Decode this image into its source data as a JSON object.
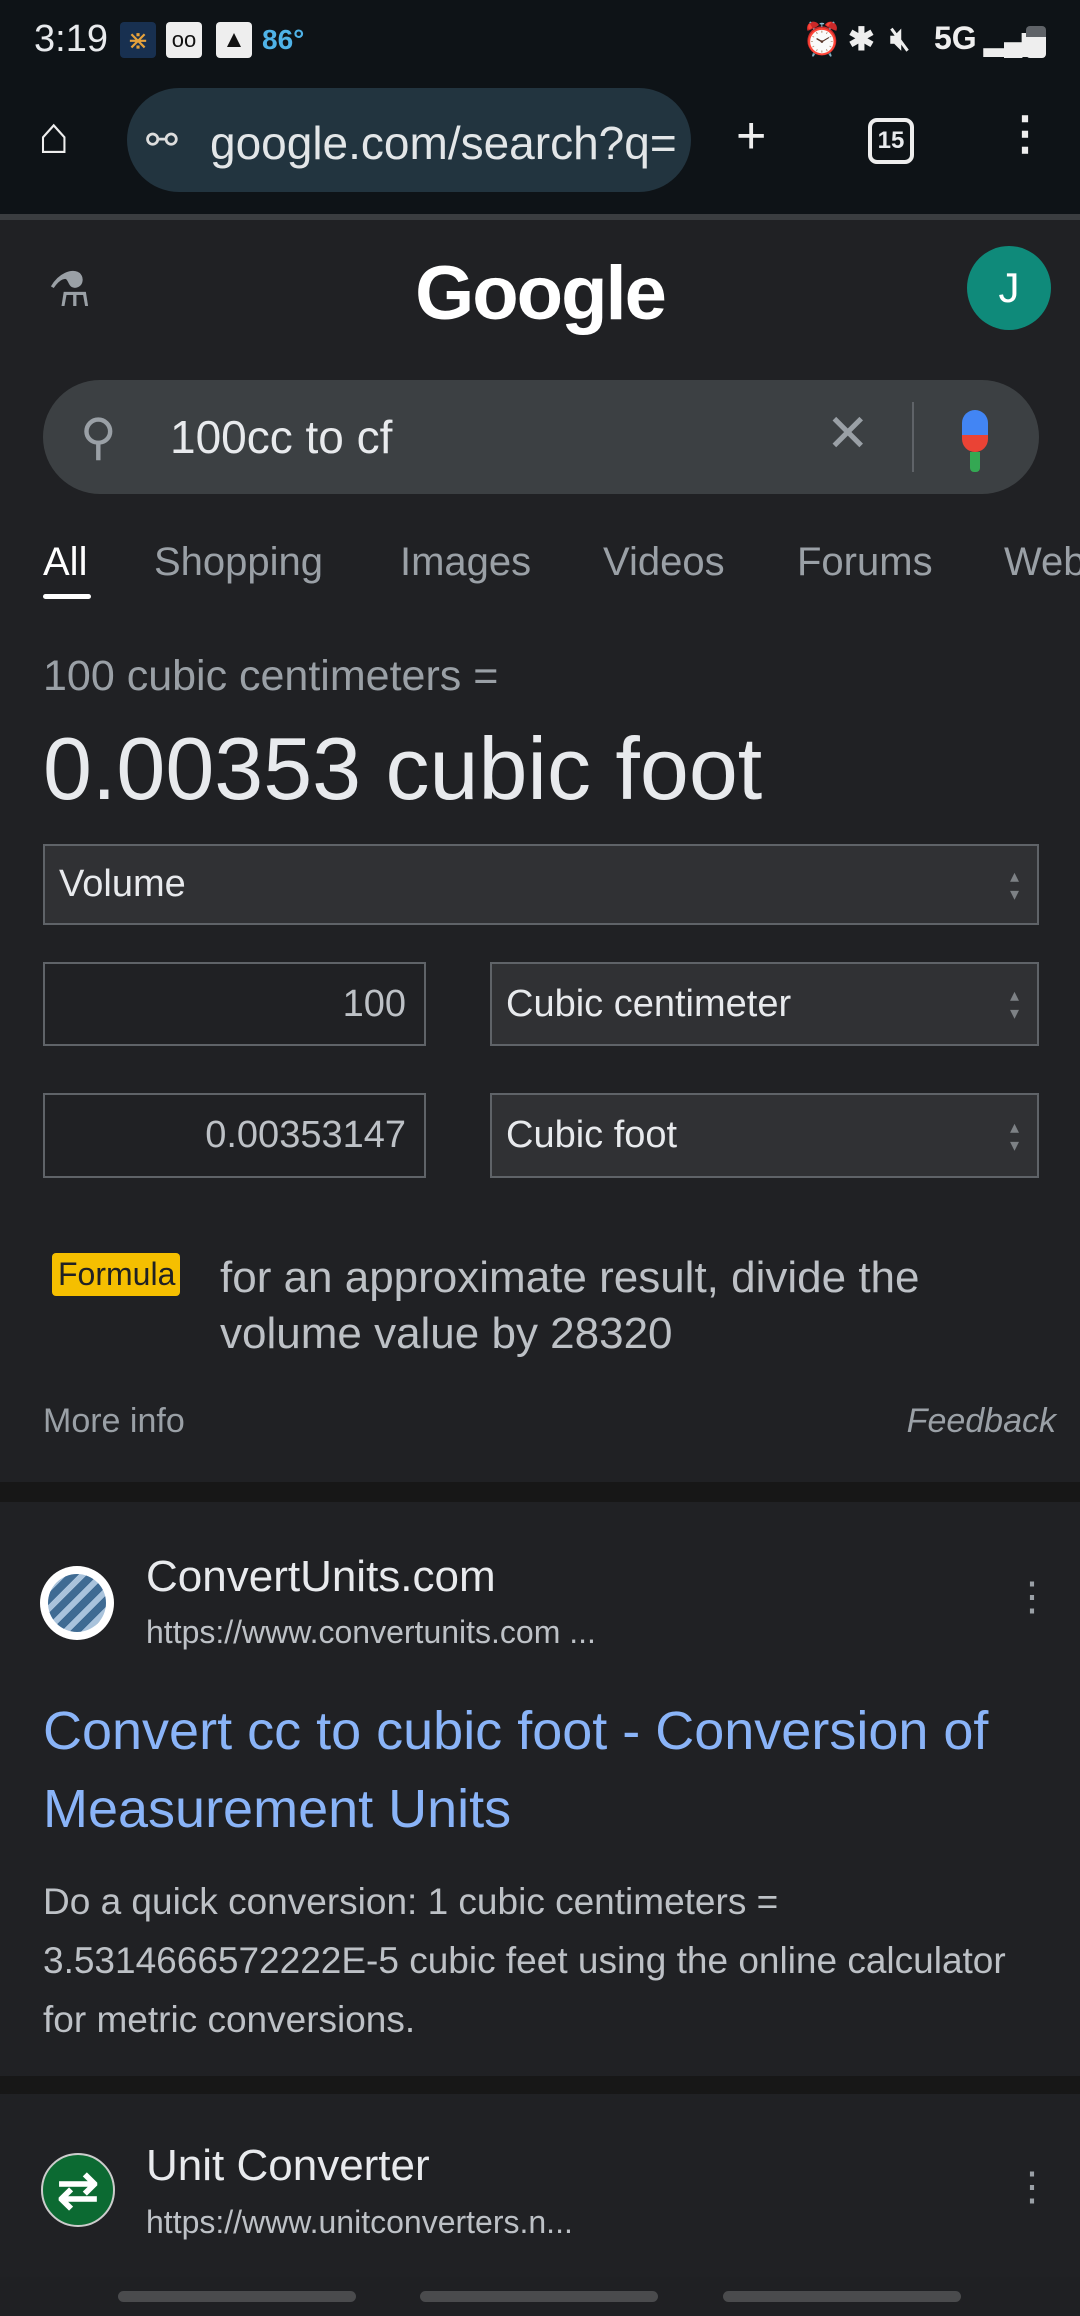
{
  "status_bar": {
    "time": "3:19",
    "temperature": "86°",
    "network": "5G",
    "icons": [
      "app-icon",
      "voicemail-icon",
      "image-icon",
      "alarm-icon",
      "bluetooth-icon",
      "mute-icon",
      "signal-icon",
      "battery-icon"
    ]
  },
  "browser": {
    "url": "google.com/search?q=",
    "tab_count": "15"
  },
  "google": {
    "logo": "Google",
    "avatar_letter": "J",
    "query": "100cc to cf",
    "tabs": [
      "All",
      "Shopping",
      "Images",
      "Videos",
      "Forums",
      "Web"
    ]
  },
  "converter": {
    "subtitle": "100 cubic centimeters =",
    "result": "0.00353 cubic foot",
    "category": "Volume",
    "from_value": "100",
    "from_unit": "Cubic centimeter",
    "to_value": "0.00353147",
    "to_unit": "Cubic foot",
    "formula_label": "Formula",
    "formula_text": "for an approximate result, divide the volume value by 28320",
    "more_info": "More info",
    "feedback": "Feedback"
  },
  "results": [
    {
      "site": "ConvertUnits.com",
      "url": "https://www.convertunits.com ...",
      "title": "Convert cc to cubic foot - Conversion of Measurement Units",
      "snippet": "Do a quick conversion: 1 cubic centimeters = 3.5314666572222E-5 cubic feet using the online calculator for metric conversions."
    },
    {
      "site": "Unit Converter",
      "url": "https://www.unitconverters.n..."
    }
  ],
  "colors": {
    "link": "#8ab4f8",
    "formula_badge": "#f5bf00",
    "avatar": "#0f8a7a",
    "background": "#202124"
  }
}
